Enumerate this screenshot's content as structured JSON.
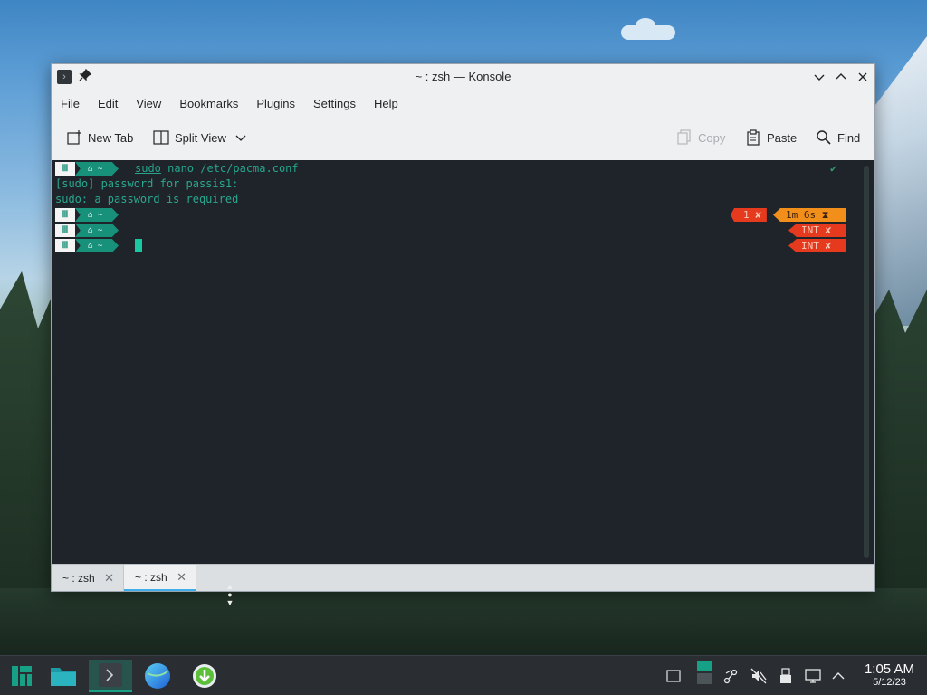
{
  "window": {
    "title": "~ : zsh — Konsole"
  },
  "menubar": {
    "items": [
      "File",
      "Edit",
      "View",
      "Bookmarks",
      "Plugins",
      "Settings",
      "Help"
    ]
  },
  "toolbar": {
    "new_tab": "New Tab",
    "split_view": "Split View",
    "copy": "Copy",
    "paste": "Paste",
    "find": "Find"
  },
  "terminal": {
    "prompt_icon_1": "Ⅲ",
    "prompt_path": "⌂ ~",
    "cmd_sudo": "sudo",
    "cmd_rest": " nano /etc/pacma.conf",
    "out_1": "[sudo] password for passis1:",
    "out_2": "sudo: a password is required",
    "check": "✔",
    "badge_status": "1 ✘",
    "badge_time": "1m 6s ⧗",
    "badge_int_1": "INT ✘",
    "badge_int_2": "INT ✘"
  },
  "tabs": [
    {
      "label": "~ : zsh",
      "close": "✕"
    },
    {
      "label": "~ : zsh",
      "close": "✕"
    }
  ],
  "taskbar": {
    "time": "1:05 AM",
    "date": "5/12/23"
  },
  "colors": {
    "accent": "#3daee9",
    "terminal_bg": "#1f242b",
    "terminal_fg": "#2aa88f",
    "prompt_teal": "#17917a",
    "error_red": "#e53a1e",
    "time_orange": "#f28e1a"
  }
}
